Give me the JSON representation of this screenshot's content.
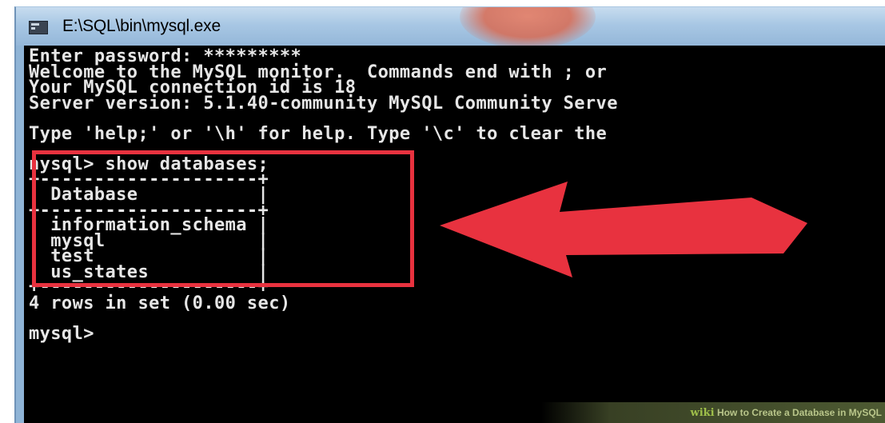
{
  "window": {
    "title": "E:\\SQL\\bin\\mysql.exe",
    "icon": "console-icon"
  },
  "console": {
    "lines": [
      "Enter password: *********",
      "Welcome to the MySQL monitor.  Commands end with ; or",
      "Your MySQL connection id is 18",
      "Server version: 5.1.40-community MySQL Community Serve",
      "",
      "Type 'help;' or '\\h' for help. Type '\\c' to clear the",
      "",
      "nysql> show databases;",
      "+--------------------+",
      "| Database           |",
      "+--------------------+",
      "| information_schema |",
      "| mysql              |",
      "| test               |",
      "| us_states          |",
      "+--------------------+",
      "4 rows in set (0.00 sec)",
      "",
      "mysql>"
    ]
  },
  "annotation": {
    "highlight_color": "#e8323f",
    "arrow_color": "#e8323f",
    "arrow_icon": "left-arrow-icon"
  },
  "watermark": {
    "brand": "wiki",
    "text": "How to Create a Database in MySQL"
  }
}
